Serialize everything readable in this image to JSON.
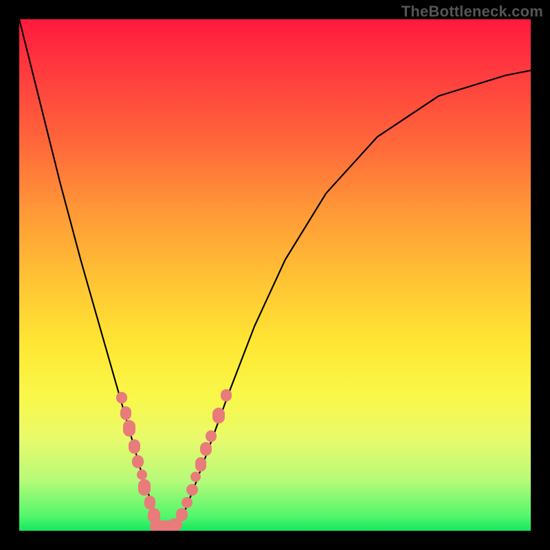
{
  "watermark": "TheBottleneck.com",
  "colors": {
    "marker": "#e97b7b",
    "curve": "#000000",
    "frame": "#000000"
  },
  "chart_data": {
    "type": "line",
    "title": "",
    "xlabel": "",
    "ylabel": "",
    "xlim": [
      0,
      100
    ],
    "ylim": [
      0,
      100
    ],
    "grid": false,
    "legend": false,
    "annotations": [
      "TheBottleneck.com"
    ],
    "series": [
      {
        "name": "bottleneck-curve",
        "x": [
          0,
          2,
          5,
          8,
          12,
          16,
          20,
          22,
          24,
          26,
          27,
          28.5,
          30,
          32,
          34,
          37,
          41,
          46,
          52,
          60,
          70,
          82,
          95,
          100
        ],
        "y": [
          100,
          92,
          80,
          68,
          53,
          39,
          25,
          18,
          11,
          5,
          2,
          0.5,
          0.5,
          3,
          8,
          16,
          27,
          40,
          53,
          66,
          77,
          85,
          89,
          90
        ]
      }
    ],
    "markers": {
      "name": "data-point-markers",
      "note": "Salmon-colored rounded markers (circles and pills) overlaid near the V-minimum region of the curve. Coordinates (x, y) in chart-space 0–100; w/h are approx marker sizes in the same units.",
      "points": [
        {
          "x": 20.0,
          "y": 26.0,
          "w": 2.2,
          "h": 2.2
        },
        {
          "x": 20.8,
          "y": 23.0,
          "w": 2.2,
          "h": 2.6
        },
        {
          "x": 21.5,
          "y": 20.0,
          "w": 2.4,
          "h": 3.2
        },
        {
          "x": 22.5,
          "y": 16.5,
          "w": 2.2,
          "h": 2.8
        },
        {
          "x": 23.2,
          "y": 13.5,
          "w": 2.2,
          "h": 2.6
        },
        {
          "x": 24.0,
          "y": 11.0,
          "w": 2.0,
          "h": 2.0
        },
        {
          "x": 24.5,
          "y": 8.5,
          "w": 2.4,
          "h": 3.2
        },
        {
          "x": 25.5,
          "y": 5.5,
          "w": 2.2,
          "h": 2.6
        },
        {
          "x": 26.3,
          "y": 3.0,
          "w": 2.4,
          "h": 3.0
        },
        {
          "x": 28.0,
          "y": 0.8,
          "w": 5.0,
          "h": 2.4
        },
        {
          "x": 30.5,
          "y": 1.2,
          "w": 2.6,
          "h": 2.4
        },
        {
          "x": 31.8,
          "y": 3.2,
          "w": 2.2,
          "h": 2.6
        },
        {
          "x": 32.8,
          "y": 5.5,
          "w": 2.2,
          "h": 2.2
        },
        {
          "x": 33.8,
          "y": 8.0,
          "w": 2.2,
          "h": 2.4
        },
        {
          "x": 34.5,
          "y": 10.5,
          "w": 2.0,
          "h": 2.0
        },
        {
          "x": 35.5,
          "y": 13.0,
          "w": 2.2,
          "h": 2.8
        },
        {
          "x": 36.5,
          "y": 16.0,
          "w": 2.2,
          "h": 2.6
        },
        {
          "x": 37.5,
          "y": 18.5,
          "w": 2.2,
          "h": 2.2
        },
        {
          "x": 39.0,
          "y": 22.5,
          "w": 2.4,
          "h": 3.0
        },
        {
          "x": 40.5,
          "y": 26.5,
          "w": 2.2,
          "h": 2.4
        }
      ]
    }
  }
}
